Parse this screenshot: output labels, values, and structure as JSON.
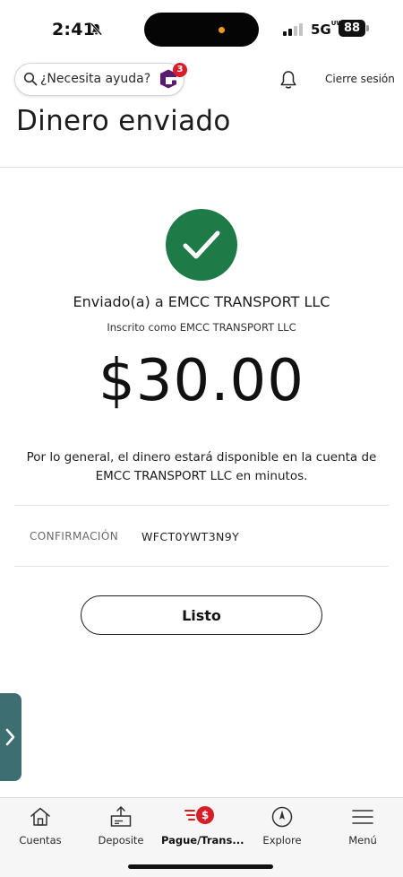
{
  "status_bar": {
    "time": "2:41",
    "network": "5G",
    "network_sup": "UW",
    "battery": "88"
  },
  "header": {
    "search_placeholder": "¿Necesita ayuda?",
    "assistant_badge": "3",
    "signout_label": "Cierre sesión",
    "title": "Dinero enviado"
  },
  "confirmation": {
    "sent_to": "Enviado(a) a EMCC TRANSPORT LLC",
    "enrolled_as": "Inscrito como EMCC TRANSPORT LLC",
    "amount": "$30.00",
    "availability_message": "Por lo general, el dinero estará disponible en la cuenta de EMCC TRANSPORT LLC en minutos.",
    "confirmation_label": "CONFIRMACIÓN",
    "confirmation_code": "WFCT0YWT3N9Y",
    "done_label": "Listo"
  },
  "bottom_nav": {
    "items": [
      {
        "label": "Cuentas",
        "icon": "home-icon",
        "active": false
      },
      {
        "label": "Deposite",
        "icon": "deposit-icon",
        "active": false
      },
      {
        "label": "Pague/Trans...",
        "icon": "pay-transfer-icon",
        "active": true
      },
      {
        "label": "Explore",
        "icon": "compass-icon",
        "active": false
      },
      {
        "label": "Menú",
        "icon": "hamburger-menu-icon",
        "active": false
      }
    ]
  },
  "colors": {
    "success_green": "#1e7a46",
    "brand_red": "#d71e28",
    "assistant_purple": "#5a1a6e",
    "side_tab_teal": "#3d6f72"
  }
}
